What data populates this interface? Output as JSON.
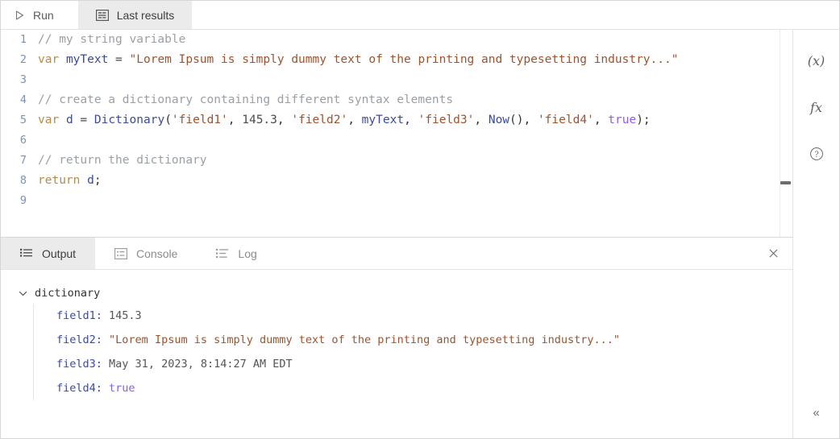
{
  "toolbar": {
    "run_label": "Run",
    "run_icon": "play-icon",
    "last_results_label": "Last results",
    "last_results_icon": "results-table-icon"
  },
  "editor": {
    "lines": [
      {
        "number": "1",
        "tokens": [
          {
            "text": "// my string variable",
            "type": "comment"
          }
        ]
      },
      {
        "number": "2",
        "tokens": [
          {
            "text": "var",
            "type": "kw"
          },
          {
            "text": " ",
            "type": "plain"
          },
          {
            "text": "myText",
            "type": "var"
          },
          {
            "text": " = ",
            "type": "op"
          },
          {
            "text": "\"Lorem Ipsum is simply dummy text of the printing and typesetting industry...\"",
            "type": "str"
          }
        ]
      },
      {
        "number": "3",
        "tokens": []
      },
      {
        "number": "4",
        "tokens": [
          {
            "text": "// create a dictionary containing different syntax elements",
            "type": "comment"
          }
        ]
      },
      {
        "number": "5",
        "tokens": [
          {
            "text": "var",
            "type": "kw"
          },
          {
            "text": " ",
            "type": "plain"
          },
          {
            "text": "d",
            "type": "var"
          },
          {
            "text": " = ",
            "type": "op"
          },
          {
            "text": "Dictionary",
            "type": "fn"
          },
          {
            "text": "(",
            "type": "plain"
          },
          {
            "text": "'field1'",
            "type": "str"
          },
          {
            "text": ", ",
            "type": "plain"
          },
          {
            "text": "145.3",
            "type": "num"
          },
          {
            "text": ", ",
            "type": "plain"
          },
          {
            "text": "'field2'",
            "type": "str"
          },
          {
            "text": ", ",
            "type": "plain"
          },
          {
            "text": "myText",
            "type": "var"
          },
          {
            "text": ", ",
            "type": "plain"
          },
          {
            "text": "'field3'",
            "type": "str"
          },
          {
            "text": ", ",
            "type": "plain"
          },
          {
            "text": "Now",
            "type": "fn"
          },
          {
            "text": "(), ",
            "type": "plain"
          },
          {
            "text": "'field4'",
            "type": "str"
          },
          {
            "text": ", ",
            "type": "plain"
          },
          {
            "text": "true",
            "type": "bool"
          },
          {
            "text": ");",
            "type": "plain"
          }
        ]
      },
      {
        "number": "6",
        "tokens": []
      },
      {
        "number": "7",
        "tokens": [
          {
            "text": "// return the dictionary",
            "type": "comment"
          }
        ]
      },
      {
        "number": "8",
        "tokens": [
          {
            "text": "return",
            "type": "kw"
          },
          {
            "text": " ",
            "type": "plain"
          },
          {
            "text": "d",
            "type": "var"
          },
          {
            "text": ";",
            "type": "plain"
          }
        ]
      },
      {
        "number": "9",
        "tokens": []
      }
    ]
  },
  "output_panel": {
    "tabs": [
      {
        "label": "Output",
        "icon": "output-list-icon",
        "active": true
      },
      {
        "label": "Console",
        "icon": "console-list-icon",
        "active": false
      },
      {
        "label": "Log",
        "icon": "log-list-icon",
        "active": false
      }
    ],
    "close_icon": "close-icon",
    "root_label": "dictionary",
    "root_caret": "chevron-down-icon",
    "rows": [
      {
        "key": "field1",
        "sep": ": ",
        "value": "145.3",
        "value_type": "num"
      },
      {
        "key": "field2",
        "sep": ": ",
        "value": "\"Lorem Ipsum is simply dummy text of the printing and typesetting industry...\"",
        "value_type": "str"
      },
      {
        "key": "field3",
        "sep": ": ",
        "value": "May 31, 2023, 8:14:27 AM EDT",
        "value_type": "date"
      },
      {
        "key": "field4",
        "sep": ": ",
        "value": "true",
        "value_type": "bool"
      }
    ]
  },
  "right_rail": {
    "buttons": [
      {
        "label": "(x)",
        "icon": "variables-icon"
      },
      {
        "label": "fx",
        "icon": "functions-icon"
      },
      {
        "label": "?",
        "icon": "help-icon"
      }
    ],
    "collapse_label": "«",
    "collapse_icon": "collapse-panel-icon"
  },
  "colors": {
    "accent_keyword": "#b58b46",
    "accent_variable": "#3b4a9e",
    "accent_string": "#a0522d",
    "accent_boolean": "#8b5cf6",
    "accent_comment": "#9aa0a6",
    "tab_active_bg": "#ebebeb"
  }
}
